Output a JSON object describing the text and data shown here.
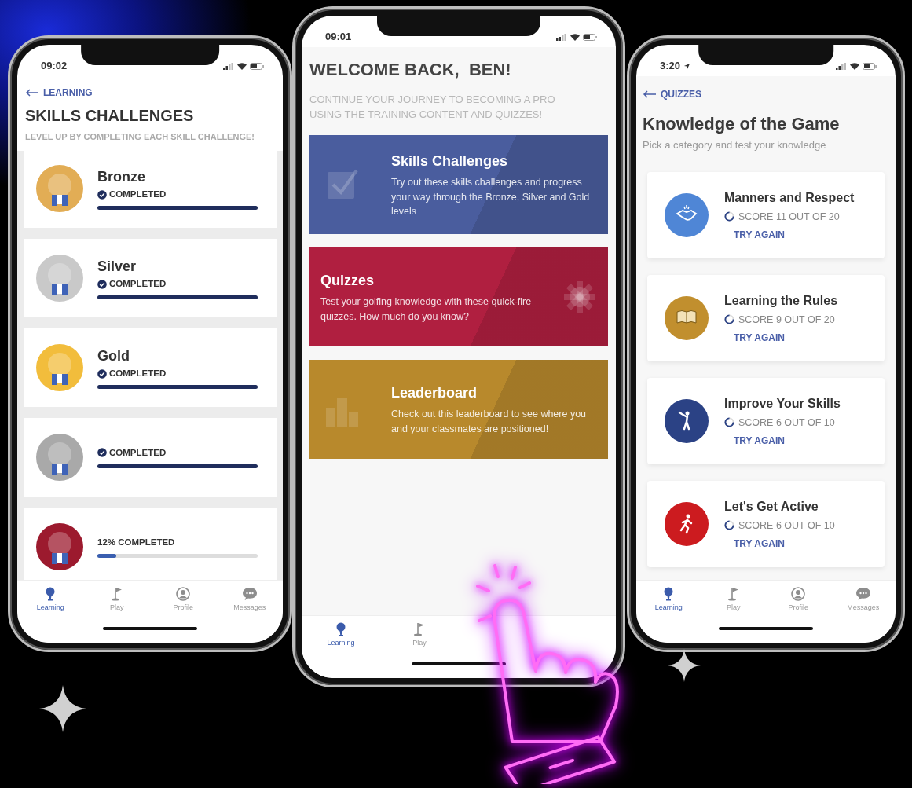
{
  "phones": [
    {
      "kind": "levels",
      "time": "09:02",
      "back_link": "LEARNING",
      "title": "SKILLS CHALLENGES",
      "subtitle": "LEVEL UP BY COMPLETING EACH SKILL CHALLENGE!",
      "levels": [
        {
          "name": "Bronze",
          "status": "COMPLETED",
          "completed": true,
          "level": 1,
          "color": "#e2ad55"
        },
        {
          "name": "Silver",
          "status": "COMPLETED",
          "completed": true,
          "level": 1,
          "color": "#c9c9c9"
        },
        {
          "name": "Gold",
          "status": "COMPLETED",
          "completed": true,
          "level": 1,
          "color": "#f2bd3c"
        },
        {
          "status": "COMPLETED",
          "completed": true,
          "level": 1,
          "color": "#a9a9a9"
        },
        {
          "status": "12% COMPLETED",
          "completed": false,
          "level": 0.12,
          "color": "#9c1a2e"
        }
      ],
      "tabs": [
        {
          "kind": "learning",
          "label": "Learning",
          "selected": true
        },
        {
          "kind": "play",
          "label": "Play",
          "selected": false
        },
        {
          "kind": "profile",
          "label": "Profile",
          "selected": false
        },
        {
          "kind": "messages",
          "label": "Messages",
          "selected": false
        }
      ]
    },
    {
      "kind": "home",
      "time": "09:01",
      "title": "WELCOME BACK,  BEN!",
      "subtitle": "CONTINUE YOUR JOURNEY TO BECOMING A PRO USING THE TRAINING CONTENT AND QUIZZES!",
      "cards": [
        {
          "kind": "check",
          "title": "Skills Challenges",
          "text": "Try out these skills challenges and progress your way through the Bronze, Silver and Gold levels",
          "color": "#4a5d9e"
        },
        {
          "kind": "gear",
          "title": "Quizzes",
          "text": "Test your golfing knowledge with these quick-fire quizzes. How much do you know?",
          "color": "#b01f40"
        },
        {
          "kind": "podium",
          "title": "Leaderboard",
          "text": "Check out this leaderboard to see where you and your classmates are positioned!",
          "color": "#b8892c"
        }
      ],
      "tabs": [
        {
          "kind": "learning",
          "label": "Learning",
          "selected": true
        },
        {
          "kind": "play",
          "label": "Play",
          "selected": false
        }
      ]
    },
    {
      "kind": "quizzes",
      "time": "3:20",
      "location_services": true,
      "back_link": "QUIZZES",
      "title": "Knowledge of the Game",
      "subtitle": "Pick a category and test your knowledge",
      "quizzes": [
        {
          "kind": "handshake",
          "title": "Manners and Respect",
          "score": "SCORE 11 OUT OF 20",
          "action": "TRY AGAIN",
          "color": "#4f86d6"
        },
        {
          "kind": "book",
          "title": "Learning the Rules",
          "score": "SCORE 9 OUT OF 20",
          "action": "TRY AGAIN",
          "color": "#c18f2e"
        },
        {
          "kind": "golfer",
          "title": "Improve Your Skills",
          "score": "SCORE 6 OUT OF 10",
          "action": "TRY AGAIN",
          "color": "#2b4285"
        },
        {
          "kind": "runner",
          "title": "Let's Get Active",
          "score": "SCORE 6 OUT OF 10",
          "action": "TRY AGAIN",
          "color": "#cc1b1f"
        }
      ],
      "tabs": [
        {
          "kind": "learning",
          "label": "Learning",
          "selected": true
        },
        {
          "kind": "play",
          "label": "Play",
          "selected": false
        },
        {
          "kind": "profile",
          "label": "Profile",
          "selected": false
        },
        {
          "kind": "messages",
          "label": "Messages",
          "selected": false
        }
      ]
    }
  ]
}
